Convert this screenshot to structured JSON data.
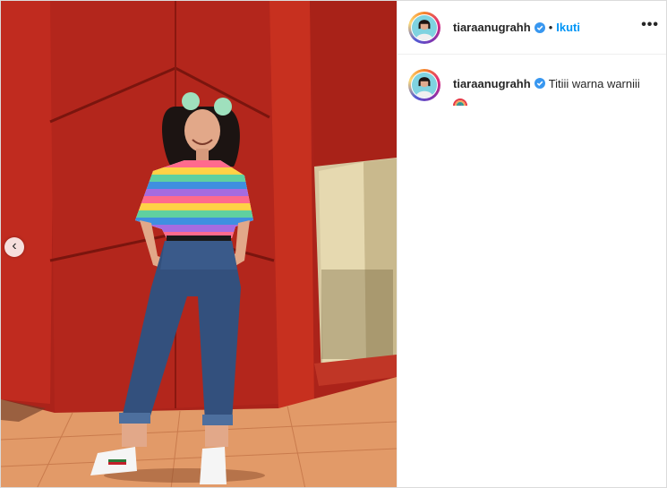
{
  "post": {
    "username": "tiaraanugrahh",
    "follow_label": "Ikuti",
    "dot": "•",
    "more": "•••",
    "caption": "Titiii warna warniii",
    "caption_emoji": "rainbow-emoji"
  },
  "media": {
    "prev_arrow": "‹"
  },
  "colors": {
    "verified": "#3897f0",
    "follow": "#0095f6",
    "wall": "#b1261b"
  }
}
